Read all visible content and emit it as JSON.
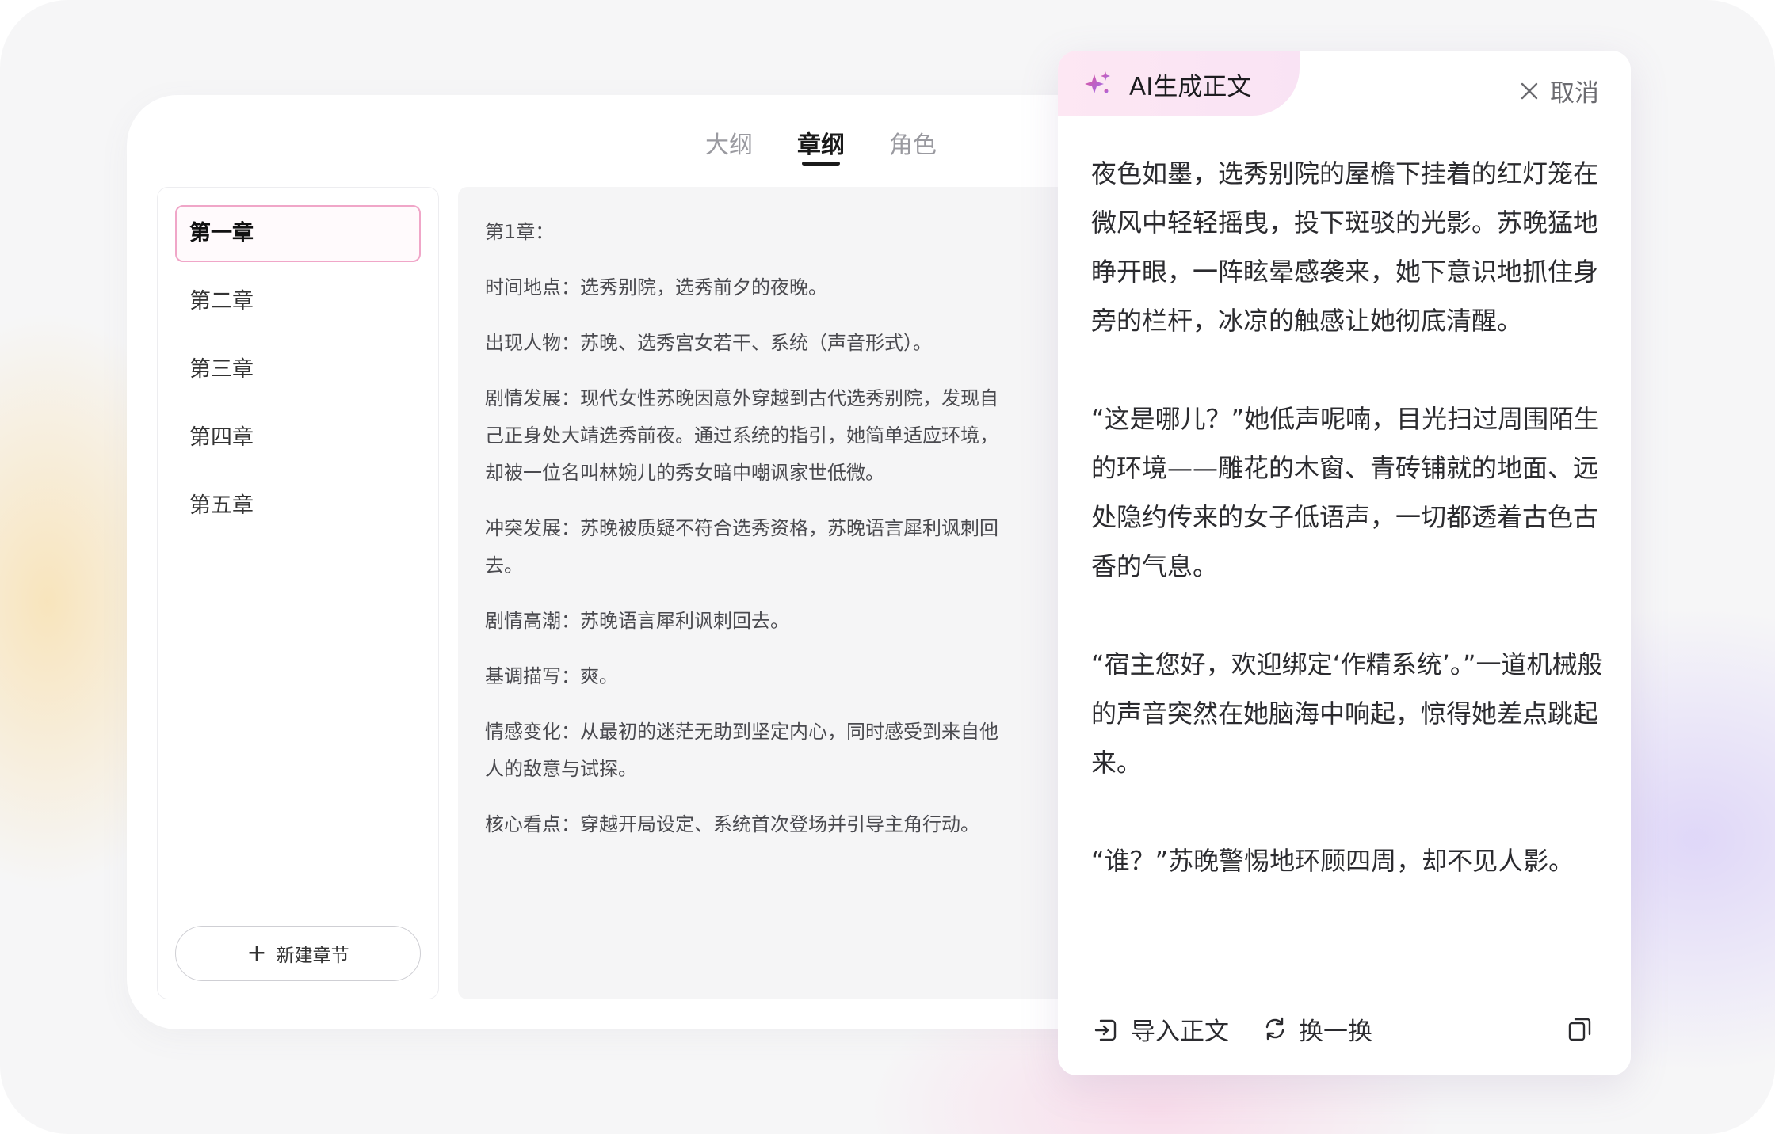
{
  "tabs": [
    {
      "label": "大纲"
    },
    {
      "label": "章纲"
    },
    {
      "label": "角色"
    }
  ],
  "active_tab": "章纲",
  "chapters": [
    {
      "label": "第一章"
    },
    {
      "label": "第二章"
    },
    {
      "label": "第三章"
    },
    {
      "label": "第四章"
    },
    {
      "label": "第五章"
    }
  ],
  "new_chapter_label": "新建章节",
  "outline": {
    "heading": "第1章：",
    "lines": [
      "时间地点：选秀别院，选秀前夕的夜晚。",
      "出现人物：苏晚、选秀宫女若干、系统（声音形式）。",
      "剧情发展：现代女性苏晚因意外穿越到古代选秀别院，发现自己正身处大靖选秀前夜。通过系统的指引，她简单适应环境，却被一位名叫林婉儿的秀女暗中嘲讽家世低微。",
      "冲突发展：苏晚被质疑不符合选秀资格，苏晚语言犀利讽刺回去。",
      "剧情高潮：苏晚语言犀利讽刺回去。",
      "基调描写：爽。",
      "情感变化：从最初的迷茫无助到坚定内心，同时感受到来自他人的敌意与试探。",
      "核心看点：穿越开局设定、系统首次登场并引导主角行动。"
    ]
  },
  "ai_panel": {
    "title": "AI生成正文",
    "cancel_label": "取消",
    "paragraphs": [
      "夜色如墨，选秀别院的屋檐下挂着的红灯笼在微风中轻轻摇曳，投下斑驳的光影。苏晚猛地睁开眼，一阵眩晕感袭来，她下意识地抓住身旁的栏杆，冰凉的触感让她彻底清醒。",
      "“这是哪儿？”她低声呢喃，目光扫过周围陌生的环境——雕花的木窗、青砖铺就的地面、远处隐约传来的女子低语声，一切都透着古色古香的气息。",
      "“宿主您好，欢迎绑定‘作精系统’。”一道机械般的声音突然在她脑海中响起，惊得她差点跳起来。",
      "“谁？”苏晚警惕地环顾四周，却不见人影。"
    ],
    "import_label": "导入正文",
    "refresh_label": "换一换"
  },
  "icons": {
    "sparkle": "sparkle-icon",
    "close": "close-icon",
    "import": "import-icon",
    "refresh": "refresh-icon",
    "copy": "copy-icon",
    "plus": "plus-icon"
  },
  "colors": {
    "accent_pink": "#f0a6c8",
    "sparkle_pink": "#e0559a",
    "sparkle_purple": "#9b6cf0"
  }
}
